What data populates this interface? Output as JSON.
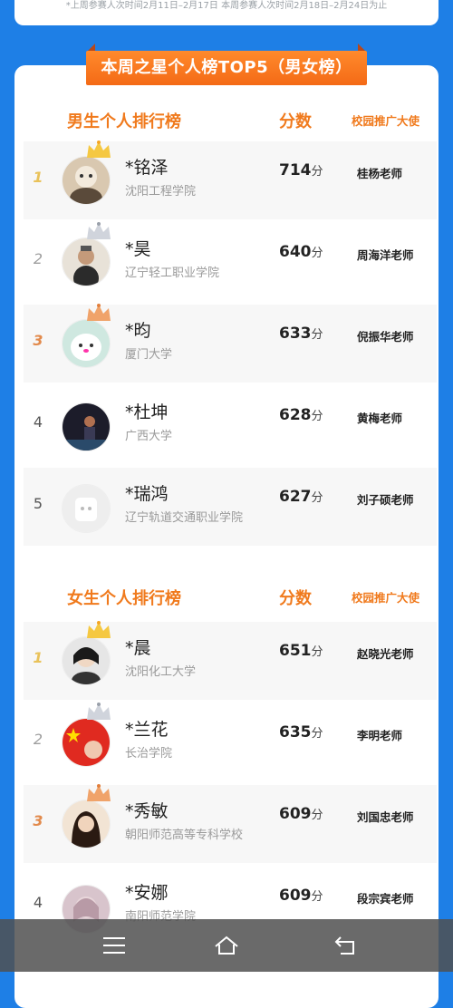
{
  "top_note": "*上周参赛人次时间2月11日–2月17日 本周参赛人次时间2月18日–2月24日为止",
  "banner_title": "本周之星个人榜TOP5（男女榜）",
  "male": {
    "title": "男生个人排行榜",
    "score_header": "分数",
    "ambassador_header": "校园推广大使",
    "rows": [
      {
        "rank": "1",
        "name": "*铭泽",
        "school": "沈阳工程学院",
        "score": "714",
        "unit": "分",
        "teacher": "桂杨老师"
      },
      {
        "rank": "2",
        "name": "*昊",
        "school": "辽宁轻工职业学院",
        "score": "640",
        "unit": "分",
        "teacher": "周海洋老师"
      },
      {
        "rank": "3",
        "name": "*昀",
        "school": "厦门大学",
        "score": "633",
        "unit": "分",
        "teacher": "倪振华老师"
      },
      {
        "rank": "4",
        "name": "*杜坤",
        "school": "广西大学",
        "score": "628",
        "unit": "分",
        "teacher": "黄梅老师"
      },
      {
        "rank": "5",
        "name": "*瑞鸿",
        "school": "辽宁轨道交通职业学院",
        "score": "627",
        "unit": "分",
        "teacher": "刘子硕老师"
      }
    ]
  },
  "female": {
    "title": "女生个人排行榜",
    "score_header": "分数",
    "ambassador_header": "校园推广大使",
    "rows": [
      {
        "rank": "1",
        "name": "*晨",
        "school": "沈阳化工大学",
        "score": "651",
        "unit": "分",
        "teacher": "赵晓光老师"
      },
      {
        "rank": "2",
        "name": "*兰花",
        "school": "长治学院",
        "score": "635",
        "unit": "分",
        "teacher": "李明老师"
      },
      {
        "rank": "3",
        "name": "*秀敏",
        "school": "朝阳师范高等专科学校",
        "score": "609",
        "unit": "分",
        "teacher": "刘国忠老师"
      },
      {
        "rank": "4",
        "name": "*安娜",
        "school": "南阳师范学院",
        "score": "609",
        "unit": "分",
        "teacher": "段宗宾老师"
      }
    ]
  },
  "colors": {
    "background": "#1e7fe6",
    "accent_orange": "#f07a1d",
    "banner_orange": "#f46a16"
  },
  "icons": [
    "menu-icon",
    "home-icon",
    "back-icon",
    "crown-icon"
  ]
}
